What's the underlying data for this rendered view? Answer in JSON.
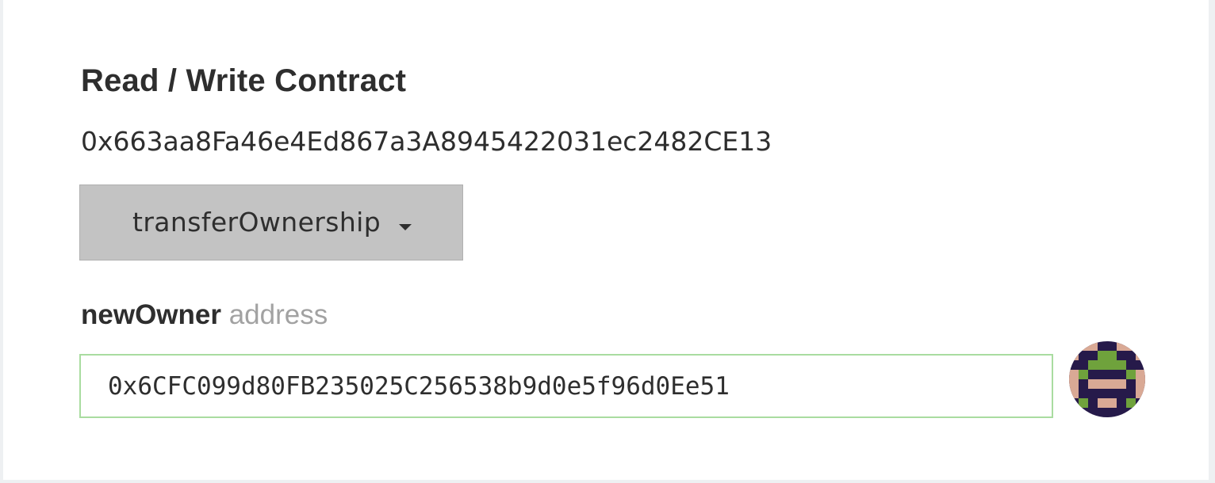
{
  "contract": {
    "title": "Read / Write Contract",
    "address": "0x663aa8Fa46e4Ed867a3A8945422031ec2482CE13"
  },
  "function_select": {
    "selected": "transferOwnership"
  },
  "param": {
    "name": "newOwner",
    "type": "address",
    "value": "0x6CFC099d80FB235025C256538b9d0e5f96d0Ee51"
  },
  "colors": {
    "input_border": "#a9dca0",
    "dropdown_bg": "#c3c3c3",
    "identicon_dark": "#261a4a",
    "identicon_green": "#6fa23c",
    "identicon_skin": "#d9a995"
  }
}
